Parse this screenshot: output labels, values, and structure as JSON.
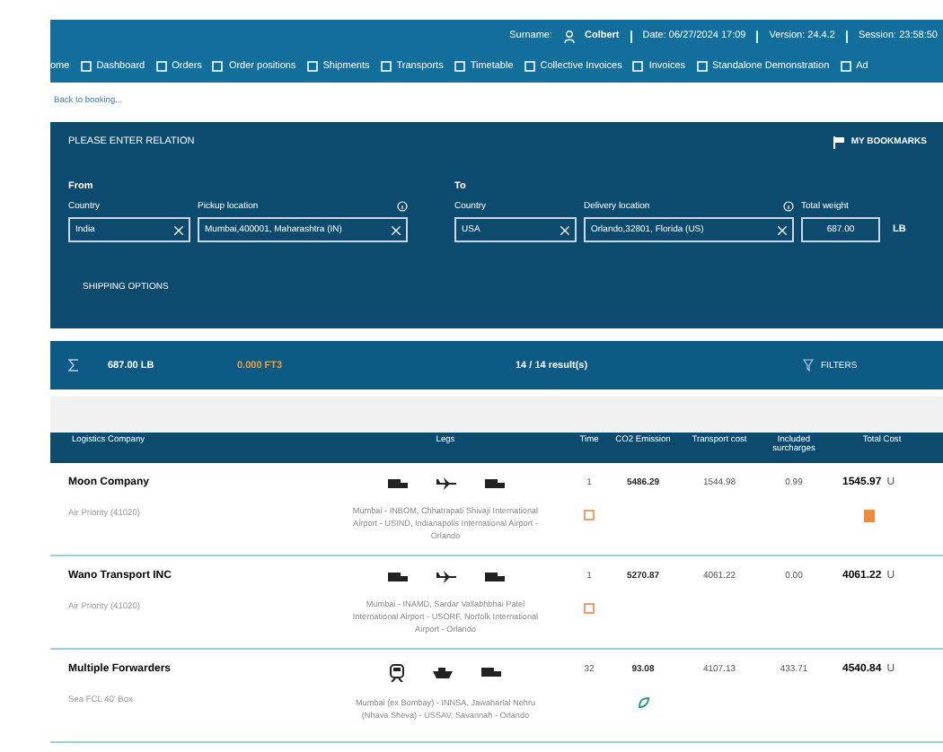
{
  "header": {
    "user_label": "Surname:",
    "user": "Colbert",
    "info": [
      "Date: 06/27/2024 17:09",
      "Version: 24.4.2",
      "Session: 23:58:50"
    ]
  },
  "nav": [
    {
      "label": "ome"
    },
    {
      "label": "Dashboard"
    },
    {
      "label": "Orders"
    },
    {
      "label": "Order positions"
    },
    {
      "label": "Shipments"
    },
    {
      "label": "Transports"
    },
    {
      "label": "Timetable"
    },
    {
      "label": "Collective Invoices"
    },
    {
      "label": "Invoices"
    },
    {
      "label": "Standalone Demonstration"
    },
    {
      "label": "Ad"
    }
  ],
  "back_link": "Back to booking...",
  "relation": {
    "title": "PLEASE ENTER RELATION",
    "bookmarks": "MY BOOKMARKS",
    "from": {
      "heading": "From",
      "country_label": "Country",
      "country": "India",
      "location_label": "Pickup location",
      "location": "Mumbai,400001, Maharashtra (IN)"
    },
    "to": {
      "heading": "To",
      "country_label": "Country",
      "country": "USA",
      "location_label": "Delivery location",
      "location": "Orlando,32801, Florida (US)"
    },
    "weight_label": "Total weight",
    "weight": "687.00",
    "weight_unit": "LB",
    "shipping_options": "SHIPPING OPTIONS"
  },
  "summary": {
    "weight": "687.00 LB",
    "volume": "0.000 FT3",
    "results": "14 / 14 result(s)",
    "filters": "FILTERS"
  },
  "table": {
    "columns": [
      "Logistics Company",
      "Legs",
      "Time",
      "CO2 Emission",
      "Transport cost",
      "Included surcharges",
      "Total Cost"
    ],
    "rows": [
      {
        "company": "Moon Company",
        "service": "Air Priority (41020)",
        "legs": [
          {
            "kind": "truck"
          },
          {
            "kind": "plane"
          },
          {
            "kind": "truck"
          }
        ],
        "route": "Mumbai - INBOM, Chhatrapati Shivaji International Airport - USIND, Indianapolis International Airport - Orlando",
        "time": "1",
        "co2": "5486.29",
        "transport": "1544.98",
        "surcharges": "0.99",
        "total": "1545.97",
        "currency": "U",
        "time_marker": {
          "kind": "box"
        },
        "total_marker": {
          "kind": "document"
        }
      },
      {
        "company": "Wano Transport INC",
        "service": "Air Priority (41020)",
        "legs": [
          {
            "kind": "truck"
          },
          {
            "kind": "plane"
          },
          {
            "kind": "truck"
          }
        ],
        "route": "Mumbai - INAMD, Sardar Vallabhbhai Patel International Airport - USORF, Norfolk International Airport - Orlando",
        "time": "1",
        "co2": "5270.87",
        "transport": "4061.22",
        "surcharges": "0.00",
        "total": "4061.22",
        "currency": "U",
        "time_marker": {
          "kind": "box"
        }
      },
      {
        "company": "Multiple Forwarders",
        "service": "Sea FCL 40' Box",
        "legs": [
          {
            "kind": "train"
          },
          {
            "kind": "ship"
          },
          {
            "kind": "truck"
          }
        ],
        "route": "Mumbai (ex Bombay) - INNSA, Jawaharlal Nehru (Nhava Sheva) - USSAV, Savannah - Orlando",
        "time": "32",
        "co2": "93.08",
        "transport": "4107.13",
        "surcharges": "433.71",
        "total": "4540.84",
        "currency": "U",
        "co2_marker": {
          "kind": "leaf"
        }
      }
    ]
  }
}
